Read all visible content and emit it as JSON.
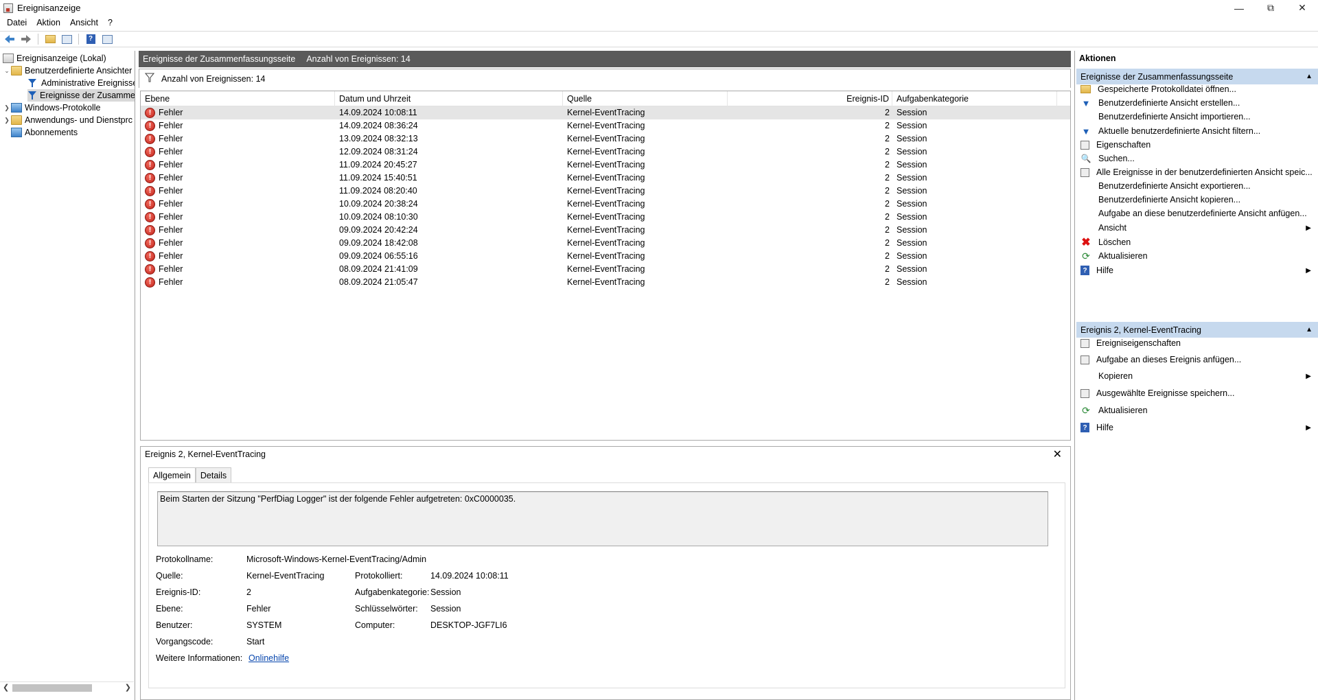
{
  "window": {
    "title": "Ereignisanzeige"
  },
  "menu": [
    "Datei",
    "Aktion",
    "Ansicht",
    "?"
  ],
  "tree": {
    "root": "Ereignisanzeige (Lokal)",
    "custom_views": "Benutzerdefinierte Ansichter",
    "admin_events": "Administrative Ereignisse",
    "summary_events": "Ereignisse der Zusammer",
    "windows_logs": "Windows-Protokolle",
    "app_logs": "Anwendungs- und Dienstprc",
    "subscriptions": "Abonnements"
  },
  "center": {
    "header_title": "Ereignisse der Zusammenfassungsseite",
    "header_count": "Anzahl von Ereignissen: 14",
    "filter_label": "Anzahl von Ereignissen: 14",
    "columns": [
      "Ebene",
      "Datum und Uhrzeit",
      "Quelle",
      "Ereignis-ID",
      "Aufgabenkategorie"
    ],
    "rows": [
      {
        "level": "Fehler",
        "date": "14.09.2024 10:08:11",
        "source": "Kernel-EventTracing",
        "id": "2",
        "category": "Session"
      },
      {
        "level": "Fehler",
        "date": "14.09.2024 08:36:24",
        "source": "Kernel-EventTracing",
        "id": "2",
        "category": "Session"
      },
      {
        "level": "Fehler",
        "date": "13.09.2024 08:32:13",
        "source": "Kernel-EventTracing",
        "id": "2",
        "category": "Session"
      },
      {
        "level": "Fehler",
        "date": "12.09.2024 08:31:24",
        "source": "Kernel-EventTracing",
        "id": "2",
        "category": "Session"
      },
      {
        "level": "Fehler",
        "date": "11.09.2024 20:45:27",
        "source": "Kernel-EventTracing",
        "id": "2",
        "category": "Session"
      },
      {
        "level": "Fehler",
        "date": "11.09.2024 15:40:51",
        "source": "Kernel-EventTracing",
        "id": "2",
        "category": "Session"
      },
      {
        "level": "Fehler",
        "date": "11.09.2024 08:20:40",
        "source": "Kernel-EventTracing",
        "id": "2",
        "category": "Session"
      },
      {
        "level": "Fehler",
        "date": "10.09.2024 20:38:24",
        "source": "Kernel-EventTracing",
        "id": "2",
        "category": "Session"
      },
      {
        "level": "Fehler",
        "date": "10.09.2024 08:10:30",
        "source": "Kernel-EventTracing",
        "id": "2",
        "category": "Session"
      },
      {
        "level": "Fehler",
        "date": "09.09.2024 20:42:24",
        "source": "Kernel-EventTracing",
        "id": "2",
        "category": "Session"
      },
      {
        "level": "Fehler",
        "date": "09.09.2024 18:42:08",
        "source": "Kernel-EventTracing",
        "id": "2",
        "category": "Session"
      },
      {
        "level": "Fehler",
        "date": "09.09.2024 06:55:16",
        "source": "Kernel-EventTracing",
        "id": "2",
        "category": "Session"
      },
      {
        "level": "Fehler",
        "date": "08.09.2024 21:41:09",
        "source": "Kernel-EventTracing",
        "id": "2",
        "category": "Session"
      },
      {
        "level": "Fehler",
        "date": "08.09.2024 21:05:47",
        "source": "Kernel-EventTracing",
        "id": "2",
        "category": "Session"
      }
    ]
  },
  "detail": {
    "title": "Ereignis 2, Kernel-EventTracing",
    "tabs": [
      "Allgemein",
      "Details"
    ],
    "description": "Beim Starten der Sitzung \"PerfDiag Logger\" ist der folgende Fehler aufgetreten: 0xC0000035.",
    "labels": {
      "log_name": "Protokollname:",
      "source": "Quelle:",
      "event_id": "Ereignis-ID:",
      "level": "Ebene:",
      "user": "Benutzer:",
      "opcode": "Vorgangscode:",
      "more_info": "Weitere Informationen:",
      "logged": "Protokolliert:",
      "task_category": "Aufgabenkategorie:",
      "keywords": "Schlüsselwörter:",
      "computer": "Computer:"
    },
    "values": {
      "log_name": "Microsoft-Windows-Kernel-EventTracing/Admin",
      "source": "Kernel-EventTracing",
      "event_id": "2",
      "level": "Fehler",
      "user": "SYSTEM",
      "opcode": "Start",
      "more_info": "Onlinehilfe",
      "logged": "14.09.2024 10:08:11",
      "task_category": "Session",
      "keywords": "Session",
      "computer": "DESKTOP-JGF7LI6"
    }
  },
  "actions": {
    "title": "Aktionen",
    "section1": "Ereignisse der Zusammenfassungsseite",
    "items1": [
      "Gespeicherte Protokolldatei öffnen...",
      "Benutzerdefinierte Ansicht erstellen...",
      "Benutzerdefinierte Ansicht importieren...",
      "Aktuelle benutzerdefinierte Ansicht filtern...",
      "Eigenschaften",
      "Suchen...",
      "Alle Ereignisse in der benutzerdefinierten Ansicht speic...",
      "Benutzerdefinierte Ansicht exportieren...",
      "Benutzerdefinierte Ansicht kopieren...",
      "Aufgabe an diese benutzerdefinierte Ansicht anfügen...",
      "Ansicht",
      "Löschen",
      "Aktualisieren",
      "Hilfe"
    ],
    "section2": "Ereignis 2, Kernel-EventTracing",
    "items2": [
      "Ereigniseigenschaften",
      "Aufgabe an dieses Ereignis anfügen...",
      "Kopieren",
      "Ausgewählte Ereignisse speichern...",
      "Aktualisieren",
      "Hilfe"
    ]
  }
}
